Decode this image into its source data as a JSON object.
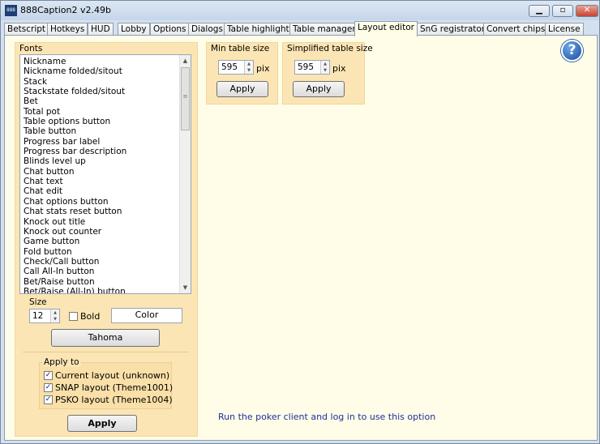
{
  "window": {
    "title": "888Caption2 v2.49b",
    "icon_text": "888"
  },
  "tabs": [
    "Betscript",
    "Hotkeys",
    "HUD",
    "Lobby",
    "Options",
    "Dialogs",
    "Table highlight",
    "Table manager",
    "Layout editor",
    "SnG registrator",
    "Convert chips",
    "License"
  ],
  "active_tab": "Layout editor",
  "fonts": {
    "label": "Fonts",
    "items": [
      "Nickname",
      "Nickname folded/sitout",
      "Stack",
      "Stackstate folded/sitout",
      "Bet",
      "Total pot",
      "Table options button",
      "Table button",
      "Progress bar label",
      "Progress bar description",
      "Blinds level up",
      "Chat button",
      "Chat text",
      "Chat edit",
      "Chat options button",
      "Chat stats reset button",
      "Knock out title",
      "Knock out counter",
      "Game button",
      "Fold button",
      "Check/Call button",
      "Call All-In button",
      "Bet/Raise button",
      "Bet/Raise (All-In) button"
    ],
    "size_label": "Size",
    "size_value": "12",
    "bold_label": "Bold",
    "color_label": "Color",
    "font_button": "Tahoma"
  },
  "apply_to": {
    "label": "Apply to",
    "options": [
      {
        "label": "Current layout (unknown)",
        "checked": true
      },
      {
        "label": "SNAP layout (Theme1001)",
        "checked": true
      },
      {
        "label": "PSKO layout (Theme1004)",
        "checked": true
      }
    ],
    "apply_button": "Apply"
  },
  "min_table": {
    "label": "Min table size",
    "value": "595",
    "unit": "pix",
    "apply_button": "Apply"
  },
  "simplified_table": {
    "label": "Simplified table size",
    "value": "595",
    "unit": "pix",
    "apply_button": "Apply"
  },
  "help_icon": "?",
  "message": "Run the poker client and log in to use this option",
  "colors": {
    "panel": "#fce5b4",
    "content_bg": "#fffde8",
    "message": "#1e2f9a",
    "help": "#1a4c9c"
  }
}
